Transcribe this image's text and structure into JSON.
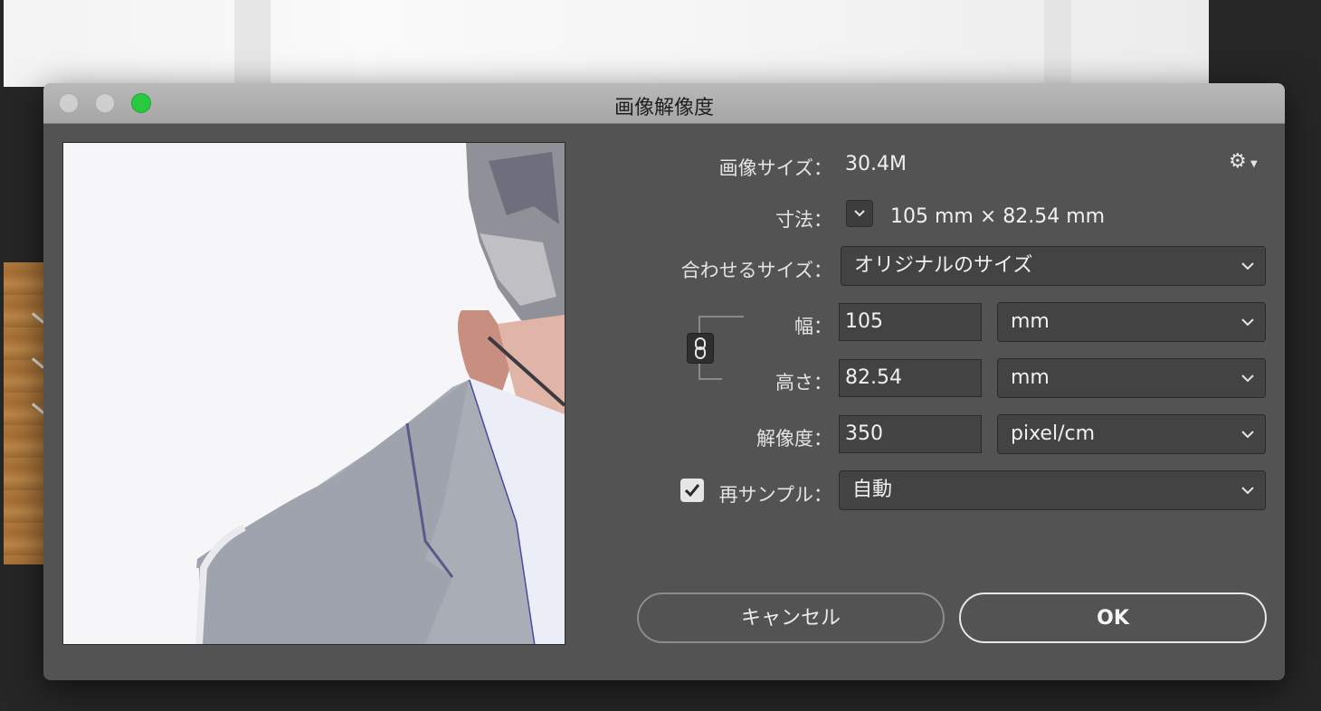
{
  "window": {
    "title": "画像解像度"
  },
  "image_size": {
    "label": "画像サイズ：",
    "value": "30.4M"
  },
  "dimensions": {
    "label": "寸法：",
    "value": "105 mm × 82.54 mm"
  },
  "fit_to": {
    "label": "合わせるサイズ：",
    "selected": "オリジナルのサイズ"
  },
  "width": {
    "label": "幅：",
    "value": "105",
    "unit": "mm"
  },
  "height": {
    "label": "高さ：",
    "value": "82.54",
    "unit": "mm"
  },
  "resolution": {
    "label": "解像度：",
    "value": "350",
    "unit": "pixel/cm"
  },
  "resample": {
    "label": "再サンプル：",
    "checked": true,
    "selected": "自動"
  },
  "buttons": {
    "cancel": "キャンセル",
    "ok": "OK"
  },
  "icons": {
    "settings": "gear-icon",
    "dimensions_toggle": "chevron-down-icon",
    "constrain": "link-icon",
    "checkbox": "checkmark-icon",
    "select_arrow": "chevron-down-icon"
  },
  "colors": {
    "zoom_button": "#28c940"
  }
}
